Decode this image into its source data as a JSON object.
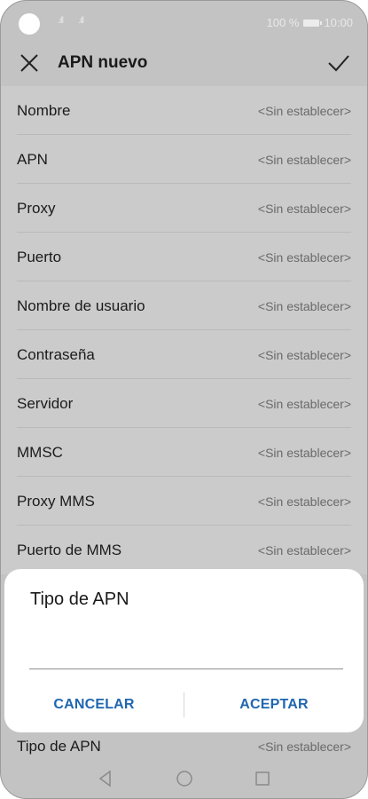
{
  "status_bar": {
    "signal_1": ".ıll",
    "signal_2": ".ıll",
    "battery_text": "100 %",
    "time": "10:00"
  },
  "toolbar": {
    "title": "APN nuevo",
    "close_icon": "close-icon",
    "confirm_icon": "check-icon"
  },
  "fields": [
    {
      "label": "Nombre",
      "value": "<Sin establecer>"
    },
    {
      "label": "APN",
      "value": "<Sin establecer>"
    },
    {
      "label": "Proxy",
      "value": "<Sin establecer>"
    },
    {
      "label": "Puerto",
      "value": "<Sin establecer>"
    },
    {
      "label": "Nombre de usuario",
      "value": "<Sin establecer>"
    },
    {
      "label": "Contraseña",
      "value": "<Sin establecer>"
    },
    {
      "label": "Servidor",
      "value": "<Sin establecer>"
    },
    {
      "label": "MMSC",
      "value": "<Sin establecer>"
    },
    {
      "label": "Proxy MMS",
      "value": "<Sin establecer>"
    },
    {
      "label": "Puerto de MMS",
      "value": "<Sin establecer>"
    }
  ],
  "bottom_field": {
    "label": "Tipo de APN",
    "value": "<Sin establecer>"
  },
  "dialog": {
    "title": "Tipo de APN",
    "input_value": "",
    "cancel_label": "CANCELAR",
    "accept_label": "ACEPTAR"
  },
  "colors": {
    "accent": "#1f66b0",
    "dim_background": "#c3c3c3",
    "dialog_background": "#ffffff"
  },
  "nav_bar": {
    "back_icon": "back-triangle-icon",
    "home_icon": "home-circle-icon",
    "recents_icon": "recents-square-icon"
  }
}
